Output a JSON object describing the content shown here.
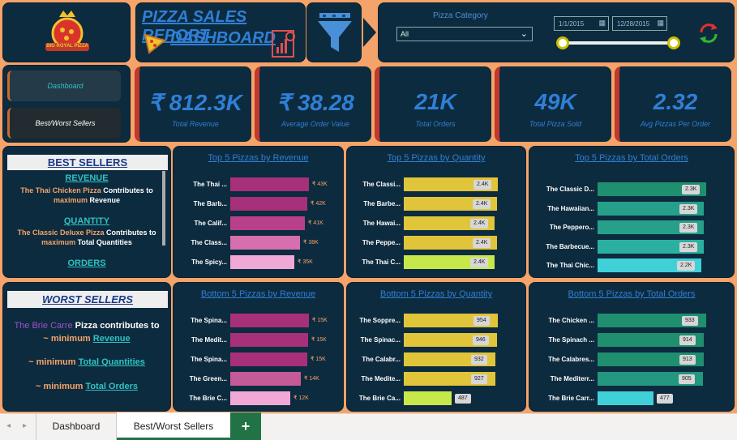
{
  "header": {
    "logo_text": "BIG ROYAL PIZZA",
    "title_line1": "PIZZA SALES REPORT",
    "title_line2": "DASHBOARD"
  },
  "filters": {
    "category_label": "Pizza Category",
    "category_value": "All",
    "date_start": "1/1/2015",
    "date_end": "12/28/2015",
    "date_range_start_fraction": 0.0,
    "date_range_end_fraction": 1.0
  },
  "nav": {
    "dashboard": "Dashboard",
    "best_worst": "Best/Worst Sellers"
  },
  "kpis": [
    {
      "value": "₹ 812.3K",
      "label": "Total Revenue"
    },
    {
      "value": "₹ 38.28",
      "label": "Average Order Value"
    },
    {
      "value": "21K",
      "label": "Total Orders"
    },
    {
      "value": "49K",
      "label": "Total Pizza Sold"
    },
    {
      "value": "2.32",
      "label": "Avg Pizzas Per Order"
    }
  ],
  "best_sellers": {
    "heading": "BEST SELLERS",
    "revenue_head": "REVENUE",
    "revenue_pizza": "The Thai Chicken Pizza",
    "revenue_t1": " Contributes to",
    "revenue_max": "maximum",
    "revenue_t2": " Revenue",
    "quantity_head": "QUANTITY",
    "quantity_pizza": "The Classic Deluxe Pizza",
    "quantity_t1": " Contributes to",
    "quantity_max": "maximum",
    "quantity_t2": " Total Quantities",
    "orders_head": "ORDERS"
  },
  "worst_sellers": {
    "heading": "WORST SELLERS",
    "pizza": "The Brie Carre",
    "t1": " Pizza contributes to",
    "tilde1": "~ minimum ",
    "revenue": "Revenue",
    "tilde2": "~ minimum  ",
    "quantities": "Total Quantities",
    "tilde3": "~ minimum  ",
    "orders": "Total Orders"
  },
  "chart_data": [
    {
      "type": "bar",
      "title": "Top 5 Pizzas by Revenue",
      "categories": [
        "The Thai ...",
        "The Barb...",
        "The Calif...",
        "The Class...",
        "The Spicy..."
      ],
      "values": [
        43,
        42,
        41,
        38,
        35
      ],
      "labels": [
        "₹ 43K",
        "₹ 42K",
        "₹ 41K",
        "₹ 38K",
        "₹ 35K"
      ],
      "colors": [
        "#a6307a",
        "#a6307a",
        "#b8408a",
        "#d66fae",
        "#f0a8d6"
      ]
    },
    {
      "type": "bar",
      "title": "Top 5 Pizzas by Quantity",
      "categories": [
        "The Classi...",
        "The Barbe...",
        "The Hawai...",
        "The Peppe...",
        "The Thai C..."
      ],
      "values": [
        2.45,
        2.43,
        2.37,
        2.42,
        2.37
      ],
      "labels": [
        "2.4K",
        "2.4K",
        "2.4K",
        "2.4K",
        "2.4K"
      ],
      "colors": [
        "#e0c43a",
        "#e0c43a",
        "#e0c43a",
        "#e0c43a",
        "#c6e84a"
      ]
    },
    {
      "type": "bar",
      "title": "Top 5 Pizzas by Total Orders",
      "categories": [
        "The Classic D...",
        "The Hawaiian...",
        "The Peppero...",
        "The Barbecue...",
        "The Thai Chic..."
      ],
      "values": [
        2.33,
        2.28,
        2.28,
        2.27,
        2.23
      ],
      "labels": [
        "2.3K",
        "2.3K",
        "2.3K",
        "2.3K",
        "2.2K"
      ],
      "colors": [
        "#1f8f6f",
        "#26a08a",
        "#26a08a",
        "#2bb0a0",
        "#40d0d8"
      ]
    },
    {
      "type": "bar",
      "title": "Bottom 5 Pizzas by Revenue",
      "categories": [
        "The Spina...",
        "The Medit...",
        "The Spina...",
        "The Green...",
        "The Brie C..."
      ],
      "values": [
        15.3,
        15.2,
        15.0,
        13.8,
        11.6
      ],
      "labels": [
        "₹ 15K",
        "₹ 15K",
        "₹ 15K",
        "₹ 14K",
        "₹ 12K"
      ],
      "colors": [
        "#a6307a",
        "#a6307a",
        "#a6307a",
        "#c45a98",
        "#f0a8d6"
      ]
    },
    {
      "type": "bar",
      "title": "Bottom 5 Pizzas by Quantity",
      "categories": [
        "The Soppre...",
        "The Spinac...",
        "The Calabr...",
        "The Medite...",
        "The Brie Ca..."
      ],
      "values": [
        954,
        946,
        932,
        927,
        487
      ],
      "labels": [
        "954",
        "946",
        "932",
        "927",
        "487"
      ],
      "colors": [
        "#e0c43a",
        "#e0c43a",
        "#e0c43a",
        "#e0c43a",
        "#c6e84a"
      ]
    },
    {
      "type": "bar",
      "title": "Bottom 5 Pizzas by Total Orders",
      "categories": [
        "The Chicken ...",
        "The Spinach ...",
        "The Calabres...",
        "The Mediterr...",
        "The Brie Carr..."
      ],
      "values": [
        933,
        914,
        913,
        905,
        477
      ],
      "labels": [
        "933",
        "914",
        "913",
        "905",
        "477"
      ],
      "colors": [
        "#1f8f6f",
        "#1f8f6f",
        "#1f8f6f",
        "#23977f",
        "#40d0d8"
      ]
    }
  ],
  "tabs": {
    "tab1": "Dashboard",
    "tab2": "Best/Worst Sellers",
    "add": "+"
  }
}
